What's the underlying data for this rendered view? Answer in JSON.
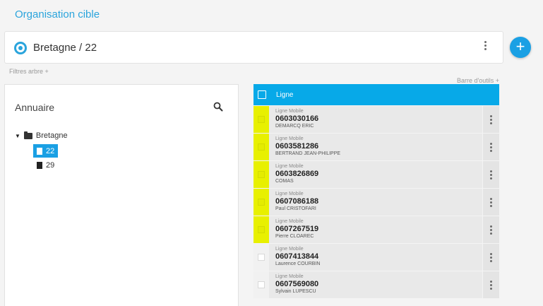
{
  "page": {
    "title": "Organisation cible"
  },
  "org": {
    "label": "Bretagne / 22"
  },
  "filters": {
    "label": "Filtres arbre +"
  },
  "toolbar": {
    "label": "Barre d'outils +"
  },
  "add_button": {
    "symbol": "+"
  },
  "tree": {
    "title": "Annuaire",
    "root": {
      "label": "Bretagne",
      "caret": "▼"
    },
    "children": [
      {
        "label": "22",
        "selected": true
      },
      {
        "label": "29",
        "selected": false
      }
    ]
  },
  "lines": {
    "header": "Ligne",
    "rows": [
      {
        "type": "Ligne Mobile",
        "number": "0603030166",
        "owner": "DEMARCQ ERIC",
        "highlighted": true
      },
      {
        "type": "Ligne Mobile",
        "number": "0603581286",
        "owner": "BERTRAND JEAN-PHILIPPE",
        "highlighted": true
      },
      {
        "type": "Ligne Mobile",
        "number": "0603826869",
        "owner": "COMAS",
        "highlighted": true
      },
      {
        "type": "Ligne Mobile",
        "number": "0607086188",
        "owner": "Paul CRISTOFARI",
        "highlighted": true
      },
      {
        "type": "Ligne Mobile",
        "number": "0607267519",
        "owner": "Pierre CLOAREC",
        "highlighted": true
      },
      {
        "type": "Ligne Mobile",
        "number": "0607413844",
        "owner": "Laurence COURBIN",
        "highlighted": false
      },
      {
        "type": "Ligne Mobile",
        "number": "0607569080",
        "owner": "Sylvain LUPESCU",
        "highlighted": false
      }
    ]
  },
  "colors": {
    "accent": "#07a9e8",
    "title": "#2aa4dc",
    "highlight": "#e8f000"
  }
}
